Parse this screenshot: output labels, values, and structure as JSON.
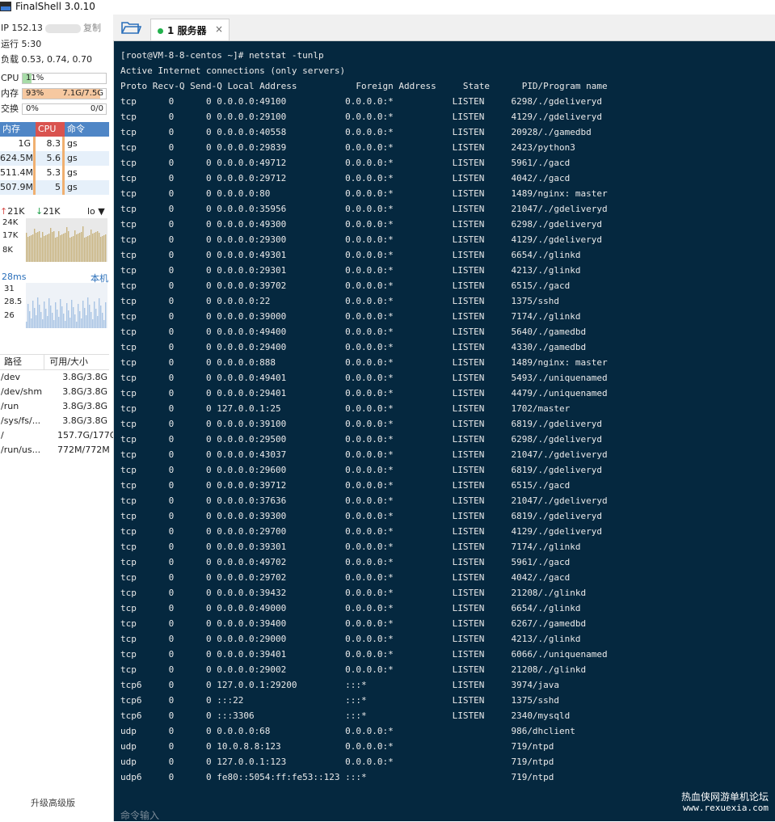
{
  "window": {
    "title": "FinalShell 3.0.10"
  },
  "sidebar": {
    "ip_label": "IP 152.13",
    "copy_label": "复制",
    "uptime": "运行 5:30",
    "load": "负载 0.53, 0.74, 0.70",
    "meters": [
      {
        "label": "CPU",
        "left": "11%",
        "right": "",
        "percent": 11,
        "color": "#a8dca8"
      },
      {
        "label": "内存",
        "left": "93%",
        "right": "7.1G/7.5G",
        "percent": 93,
        "color": "#f6c8a0"
      },
      {
        "label": "交换",
        "left": "0%",
        "right": "0/0",
        "percent": 0,
        "color": "#a8dca8"
      }
    ],
    "process_table": {
      "headers": [
        "内存",
        "CPU",
        "命令"
      ],
      "rows": [
        [
          "1G",
          "8.3",
          "gs"
        ],
        [
          "624.5M",
          "5.6",
          "gs"
        ],
        [
          "511.4M",
          "5.3",
          "gs"
        ],
        [
          "507.9M",
          "5",
          "gs"
        ]
      ]
    },
    "network": {
      "up": "21K",
      "down": "21K",
      "interface": "lo",
      "axis": [
        "24K",
        "17K",
        "8K"
      ]
    },
    "latency": {
      "value": "28ms",
      "target": "本机",
      "axis": [
        "31",
        "28.5",
        "26"
      ]
    },
    "disk_table": {
      "headers": [
        "路径",
        "可用/大小"
      ],
      "rows": [
        [
          "/dev",
          "3.8G/3.8G"
        ],
        [
          "/dev/shm",
          "3.8G/3.8G"
        ],
        [
          "/run",
          "3.8G/3.8G"
        ],
        [
          "/sys/fs/...",
          "3.8G/3.8G"
        ],
        [
          "/",
          "157.7G/177G"
        ],
        [
          "/run/us...",
          "772M/772M"
        ]
      ]
    },
    "upgrade_label": "升级高级版"
  },
  "tabs": [
    {
      "label": "1 服务器",
      "close": "×"
    }
  ],
  "terminal": {
    "prompt": "[root@VM-8-8-centos ~]# netstat -tunlp",
    "info": "Active Internet connections (only servers)",
    "headers": [
      "Proto",
      "Recv-Q",
      "Send-Q",
      "Local Address",
      "Foreign Address",
      "State",
      "PID/Program name"
    ],
    "rows": [
      [
        "tcp",
        "0",
        "0",
        "0.0.0.0:49100",
        "0.0.0.0:*",
        "LISTEN",
        "6298/./gdeliveryd"
      ],
      [
        "tcp",
        "0",
        "0",
        "0.0.0.0:29100",
        "0.0.0.0:*",
        "LISTEN",
        "4129/./gdeliveryd"
      ],
      [
        "tcp",
        "0",
        "0",
        "0.0.0.0:40558",
        "0.0.0.0:*",
        "LISTEN",
        "20928/./gamedbd"
      ],
      [
        "tcp",
        "0",
        "0",
        "0.0.0.0:29839",
        "0.0.0.0:*",
        "LISTEN",
        "2423/python3"
      ],
      [
        "tcp",
        "0",
        "0",
        "0.0.0.0:49712",
        "0.0.0.0:*",
        "LISTEN",
        "5961/./gacd"
      ],
      [
        "tcp",
        "0",
        "0",
        "0.0.0.0:29712",
        "0.0.0.0:*",
        "LISTEN",
        "4042/./gacd"
      ],
      [
        "tcp",
        "0",
        "0",
        "0.0.0.0:80",
        "0.0.0.0:*",
        "LISTEN",
        "1489/nginx: master"
      ],
      [
        "tcp",
        "0",
        "0",
        "0.0.0.0:35956",
        "0.0.0.0:*",
        "LISTEN",
        "21047/./gdeliveryd"
      ],
      [
        "tcp",
        "0",
        "0",
        "0.0.0.0:49300",
        "0.0.0.0:*",
        "LISTEN",
        "6298/./gdeliveryd"
      ],
      [
        "tcp",
        "0",
        "0",
        "0.0.0.0:29300",
        "0.0.0.0:*",
        "LISTEN",
        "4129/./gdeliveryd"
      ],
      [
        "tcp",
        "0",
        "0",
        "0.0.0.0:49301",
        "0.0.0.0:*",
        "LISTEN",
        "6654/./glinkd"
      ],
      [
        "tcp",
        "0",
        "0",
        "0.0.0.0:29301",
        "0.0.0.0:*",
        "LISTEN",
        "4213/./glinkd"
      ],
      [
        "tcp",
        "0",
        "0",
        "0.0.0.0:39702",
        "0.0.0.0:*",
        "LISTEN",
        "6515/./gacd"
      ],
      [
        "tcp",
        "0",
        "0",
        "0.0.0.0:22",
        "0.0.0.0:*",
        "LISTEN",
        "1375/sshd"
      ],
      [
        "tcp",
        "0",
        "0",
        "0.0.0.0:39000",
        "0.0.0.0:*",
        "LISTEN",
        "7174/./glinkd"
      ],
      [
        "tcp",
        "0",
        "0",
        "0.0.0.0:49400",
        "0.0.0.0:*",
        "LISTEN",
        "5640/./gamedbd"
      ],
      [
        "tcp",
        "0",
        "0",
        "0.0.0.0:29400",
        "0.0.0.0:*",
        "LISTEN",
        "4330/./gamedbd"
      ],
      [
        "tcp",
        "0",
        "0",
        "0.0.0.0:888",
        "0.0.0.0:*",
        "LISTEN",
        "1489/nginx: master"
      ],
      [
        "tcp",
        "0",
        "0",
        "0.0.0.0:49401",
        "0.0.0.0:*",
        "LISTEN",
        "5493/./uniquenamed"
      ],
      [
        "tcp",
        "0",
        "0",
        "0.0.0.0:29401",
        "0.0.0.0:*",
        "LISTEN",
        "4479/./uniquenamed"
      ],
      [
        "tcp",
        "0",
        "0",
        "127.0.0.1:25",
        "0.0.0.0:*",
        "LISTEN",
        "1702/master"
      ],
      [
        "tcp",
        "0",
        "0",
        "0.0.0.0:39100",
        "0.0.0.0:*",
        "LISTEN",
        "6819/./gdeliveryd"
      ],
      [
        "tcp",
        "0",
        "0",
        "0.0.0.0:29500",
        "0.0.0.0:*",
        "LISTEN",
        "6298/./gdeliveryd"
      ],
      [
        "tcp",
        "0",
        "0",
        "0.0.0.0:43037",
        "0.0.0.0:*",
        "LISTEN",
        "21047/./gdeliveryd"
      ],
      [
        "tcp",
        "0",
        "0",
        "0.0.0.0:29600",
        "0.0.0.0:*",
        "LISTEN",
        "6819/./gdeliveryd"
      ],
      [
        "tcp",
        "0",
        "0",
        "0.0.0.0:39712",
        "0.0.0.0:*",
        "LISTEN",
        "6515/./gacd"
      ],
      [
        "tcp",
        "0",
        "0",
        "0.0.0.0:37636",
        "0.0.0.0:*",
        "LISTEN",
        "21047/./gdeliveryd"
      ],
      [
        "tcp",
        "0",
        "0",
        "0.0.0.0:39300",
        "0.0.0.0:*",
        "LISTEN",
        "6819/./gdeliveryd"
      ],
      [
        "tcp",
        "0",
        "0",
        "0.0.0.0:29700",
        "0.0.0.0:*",
        "LISTEN",
        "4129/./gdeliveryd"
      ],
      [
        "tcp",
        "0",
        "0",
        "0.0.0.0:39301",
        "0.0.0.0:*",
        "LISTEN",
        "7174/./glinkd"
      ],
      [
        "tcp",
        "0",
        "0",
        "0.0.0.0:49702",
        "0.0.0.0:*",
        "LISTEN",
        "5961/./gacd"
      ],
      [
        "tcp",
        "0",
        "0",
        "0.0.0.0:29702",
        "0.0.0.0:*",
        "LISTEN",
        "4042/./gacd"
      ],
      [
        "tcp",
        "0",
        "0",
        "0.0.0.0:39432",
        "0.0.0.0:*",
        "LISTEN",
        "21208/./glinkd"
      ],
      [
        "tcp",
        "0",
        "0",
        "0.0.0.0:49000",
        "0.0.0.0:*",
        "LISTEN",
        "6654/./glinkd"
      ],
      [
        "tcp",
        "0",
        "0",
        "0.0.0.0:39400",
        "0.0.0.0:*",
        "LISTEN",
        "6267/./gamedbd"
      ],
      [
        "tcp",
        "0",
        "0",
        "0.0.0.0:29000",
        "0.0.0.0:*",
        "LISTEN",
        "4213/./glinkd"
      ],
      [
        "tcp",
        "0",
        "0",
        "0.0.0.0:39401",
        "0.0.0.0:*",
        "LISTEN",
        "6066/./uniquenamed"
      ],
      [
        "tcp",
        "0",
        "0",
        "0.0.0.0:29002",
        "0.0.0.0:*",
        "LISTEN",
        "21208/./glinkd"
      ],
      [
        "tcp6",
        "0",
        "0",
        "127.0.0.1:29200",
        ":::*",
        "LISTEN",
        "3974/java"
      ],
      [
        "tcp6",
        "0",
        "0",
        ":::22",
        ":::*",
        "LISTEN",
        "1375/sshd"
      ],
      [
        "tcp6",
        "0",
        "0",
        ":::3306",
        ":::*",
        "LISTEN",
        "2340/mysqld"
      ],
      [
        "udp",
        "0",
        "0",
        "0.0.0.0:68",
        "0.0.0.0:*",
        "",
        "986/dhclient"
      ],
      [
        "udp",
        "0",
        "0",
        "10.0.8.8:123",
        "0.0.0.0:*",
        "",
        "719/ntpd"
      ],
      [
        "udp",
        "0",
        "0",
        "127.0.0.1:123",
        "0.0.0.0:*",
        "",
        "719/ntpd"
      ],
      [
        "udp6",
        "0",
        "0",
        "fe80::5054:ff:fe53::123",
        ":::*",
        "",
        "719/ntpd"
      ]
    ],
    "input_placeholder": "命令输入"
  },
  "watermark": {
    "line1": "热血侠网游单机论坛",
    "line2": "www.rexuexia.com"
  },
  "colors": {
    "terminal_bg": "#05283f",
    "terminal_fg": "#eaeaea",
    "proc_header_mem": "#4f86c6",
    "proc_header_cpu": "#d9534f",
    "proc_header_cmd": "#4f86c6",
    "graph_net": "#c9b480",
    "graph_ping": "#a9c4e4",
    "tab_dot": "#22b14c"
  },
  "icons": [
    "app-icon",
    "folder-icon",
    "arrow-up-icon",
    "arrow-down-icon",
    "dropdown-icon",
    "close-icon"
  ]
}
